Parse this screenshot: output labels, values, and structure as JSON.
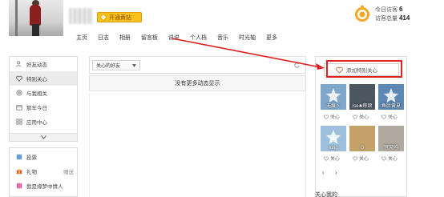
{
  "header": {
    "diamond_button": "开通黄钻",
    "visits_today_label": "今日访客",
    "visits_today": "6",
    "visits_total_label": "访客总量",
    "visits_total": "414"
  },
  "nav": [
    "主页",
    "日志",
    "相册",
    "留言板",
    "说说",
    "个人档",
    "音乐",
    "时光轴",
    "更多"
  ],
  "sidebar": {
    "items": [
      {
        "label": "好友动态",
        "icon": "friends-icon"
      },
      {
        "label": "特别关心",
        "icon": "heart-icon",
        "active": true
      },
      {
        "label": "与我相关",
        "icon": "at-icon"
      },
      {
        "label": "那年今日",
        "icon": "calendar-icon"
      },
      {
        "label": "应用中心",
        "icon": "grid-icon"
      }
    ],
    "apps": [
      {
        "label": "投票",
        "icon": "vote-icon"
      },
      {
        "label": "礼物",
        "icon": "gift-icon",
        "extra": "赠送"
      },
      {
        "label": "我是缘梦中情人",
        "icon": "app-icon"
      }
    ]
  },
  "feed": {
    "filter_label": "关心的好友",
    "empty_text": "没有更多动态显示"
  },
  "right_panel": {
    "add_button": "添加特别关心",
    "tiles": [
      {
        "name": "无痕丶",
        "color": "#7fa7c9"
      },
      {
        "name": "/se❀称颂",
        "color": "#4b5660"
      },
      {
        "name": "鱼肚黄夏",
        "color": "#5d88b4"
      },
      {
        "name": "long",
        "color": "#9cc0de"
      },
      {
        "name": "G",
        "color": "#c5a26a"
      },
      {
        "name": "宫兖昀",
        "color": "#b0a99f"
      }
    ],
    "care_label": "关心",
    "prev": "‹",
    "next": "›",
    "bottom_title": "关心我的"
  }
}
